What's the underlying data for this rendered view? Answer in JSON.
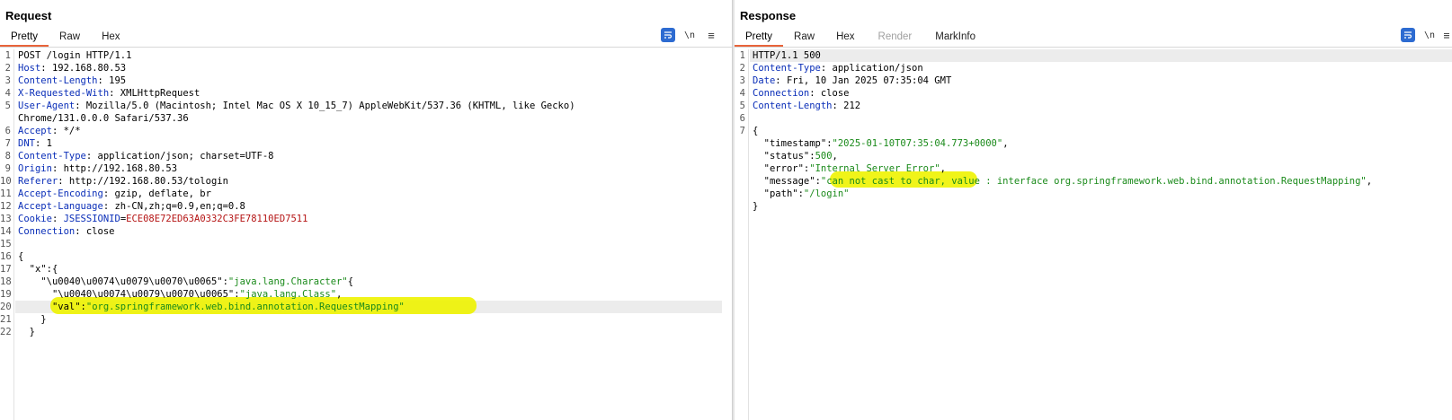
{
  "request": {
    "title": "Request",
    "tabs": [
      "Pretty",
      "Raw",
      "Hex"
    ],
    "active_tab": "Pretty",
    "tools": {
      "newline": "\\n",
      "menu": "≡"
    }
  },
  "response": {
    "title": "Response",
    "tabs": [
      "Pretty",
      "Raw",
      "Hex",
      "Render",
      "MarkInfo"
    ],
    "active_tab": "Pretty",
    "tools": {
      "newline": "\\n",
      "menu": "≡"
    }
  },
  "colors": {
    "header_name": "#0a2eb8",
    "string": "#1a8a1a",
    "cookie_value": "#b51414",
    "highlight": "#eef300",
    "tab_active": "#e8643a",
    "button_active": "#2d6bd1"
  }
}
